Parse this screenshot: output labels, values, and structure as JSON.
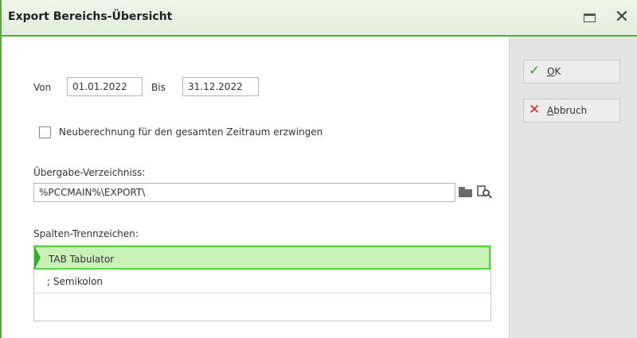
{
  "window": {
    "title": "Export Bereichs-Übersicht"
  },
  "icons": {
    "maximize": "maximize-icon",
    "close": "close-icon",
    "ok": "checkmark-icon",
    "cancel": "x-icon",
    "folder": "folder-icon",
    "browse": "browse-search-icon"
  },
  "colors": {
    "accent": "#5ba545",
    "selected_row": "#c8f0b7",
    "ok": "#3c9b2c",
    "cancel": "#d8262a"
  },
  "form": {
    "von_label": "Von",
    "von_value": "01.01.2022",
    "bis_label": "Bis",
    "bis_value": "31.12.2022",
    "recalc_label": "Neuberechnung für den gesamten Zeitraum erzwingen",
    "recalc_checked": false,
    "dir_label": "Übergabe-Verzeichniss:",
    "dir_value": "%PCCMAIN%\\EXPORT\\",
    "sep_label": "Spalten-Trennzeichen:"
  },
  "separator_options": [
    {
      "label": "TAB Tabulator",
      "selected": true
    },
    {
      "label": "; Semikolon",
      "selected": false
    },
    {
      "label": "",
      "selected": false
    }
  ],
  "buttons": {
    "ok_label_mnemonic": "O",
    "ok_label_rest": "K",
    "cancel_label_mnemonic": "A",
    "cancel_label_rest": "bbruch"
  }
}
